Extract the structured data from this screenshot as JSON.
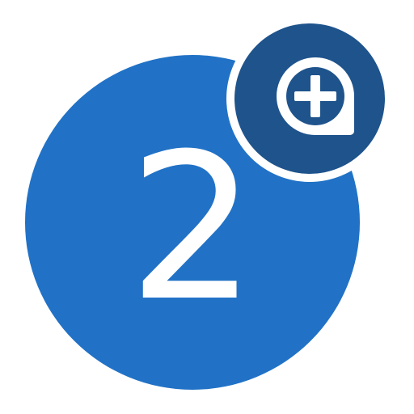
{
  "icon": {
    "digit": "2",
    "main_icon_name": "number-circle-icon",
    "badge_icon_name": "add-comment-icon",
    "colors": {
      "main_circle": "#2172c6",
      "badge_circle": "#1e538c",
      "badge_ring": "#ffffff",
      "digit": "#ffffff",
      "glyph": "#ffffff"
    }
  }
}
